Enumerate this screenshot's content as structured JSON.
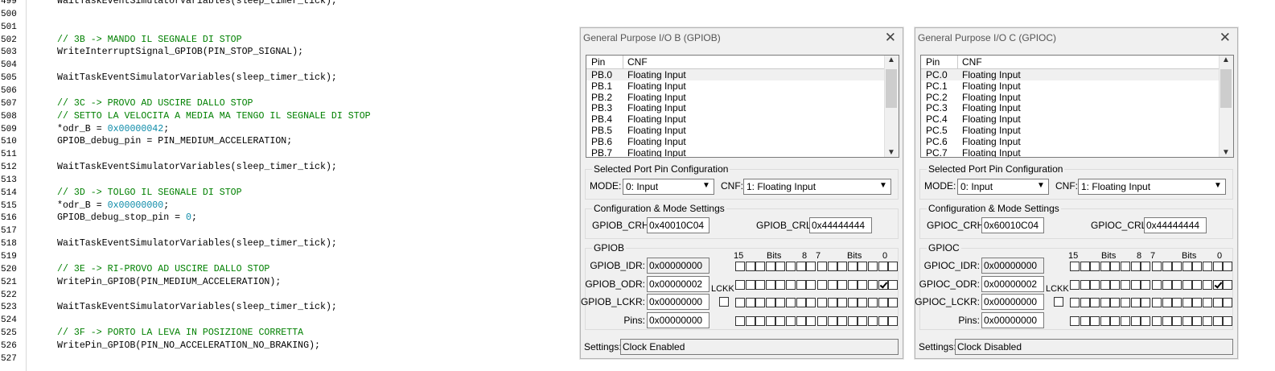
{
  "code": [
    {
      "ln": "499",
      "segments": [
        {
          "t": "WaitTaskEventSimulatorVariables(sleep_timer_tick);",
          "k": "code"
        }
      ]
    },
    {
      "ln": "500",
      "segments": []
    },
    {
      "ln": "501",
      "segments": []
    },
    {
      "ln": "502",
      "segments": [
        {
          "t": "// 3B -> MANDO IL SEGNALE DI STOP",
          "k": "comment"
        }
      ]
    },
    {
      "ln": "503",
      "segments": [
        {
          "t": "WriteInterruptSignal_GPIOB(PIN_STOP_SIGNAL);",
          "k": "code"
        }
      ]
    },
    {
      "ln": "504",
      "segments": []
    },
    {
      "ln": "505",
      "segments": [
        {
          "t": "WaitTaskEventSimulatorVariables(sleep_timer_tick);",
          "k": "code"
        }
      ]
    },
    {
      "ln": "506",
      "segments": []
    },
    {
      "ln": "507",
      "segments": [
        {
          "t": "// 3C -> PROVO AD USCIRE DALLO STOP",
          "k": "comment"
        }
      ]
    },
    {
      "ln": "508",
      "segments": [
        {
          "t": "// SETTO LA VELOCITA A MEDIA MA TENGO IL SEGNALE DI STOP",
          "k": "comment"
        }
      ]
    },
    {
      "ln": "509",
      "segments": [
        {
          "t": "*odr_B = ",
          "k": "code"
        },
        {
          "t": "0x00000042",
          "k": "num"
        },
        {
          "t": ";",
          "k": "code"
        }
      ]
    },
    {
      "ln": "510",
      "segments": [
        {
          "t": "GPIOB_debug_pin = PIN_MEDIUM_ACCELERATION;",
          "k": "code"
        }
      ]
    },
    {
      "ln": "511",
      "segments": []
    },
    {
      "ln": "512",
      "segments": [
        {
          "t": "WaitTaskEventSimulatorVariables(sleep_timer_tick);",
          "k": "code"
        }
      ]
    },
    {
      "ln": "513",
      "segments": []
    },
    {
      "ln": "514",
      "segments": [
        {
          "t": "// 3D -> TOLGO IL SEGNALE DI STOP",
          "k": "comment"
        }
      ]
    },
    {
      "ln": "515",
      "segments": [
        {
          "t": "*odr_B = ",
          "k": "code"
        },
        {
          "t": "0x00000000",
          "k": "num"
        },
        {
          "t": ";",
          "k": "code"
        }
      ]
    },
    {
      "ln": "516",
      "segments": [
        {
          "t": "GPIOB_debug_stop_pin = ",
          "k": "code"
        },
        {
          "t": "0",
          "k": "num"
        },
        {
          "t": ";",
          "k": "code"
        }
      ]
    },
    {
      "ln": "517",
      "segments": []
    },
    {
      "ln": "518",
      "segments": [
        {
          "t": "WaitTaskEventSimulatorVariables(sleep_timer_tick);",
          "k": "code"
        }
      ]
    },
    {
      "ln": "519",
      "segments": []
    },
    {
      "ln": "520",
      "segments": [
        {
          "t": "// 3E -> RI-PROVO AD USCIRE DALLO STOP",
          "k": "comment"
        }
      ]
    },
    {
      "ln": "521",
      "segments": [
        {
          "t": "WritePin_GPIOB(PIN_MEDIUM_ACCELERATION);",
          "k": "code"
        }
      ]
    },
    {
      "ln": "522",
      "segments": []
    },
    {
      "ln": "523",
      "segments": [
        {
          "t": "WaitTaskEventSimulatorVariables(sleep_timer_tick);",
          "k": "code"
        }
      ]
    },
    {
      "ln": "524",
      "segments": []
    },
    {
      "ln": "525",
      "segments": [
        {
          "t": "// 3F -> PORTO LA LEVA IN POSIZIONE CORRETTA",
          "k": "comment"
        }
      ]
    },
    {
      "ln": "526",
      "segments": [
        {
          "t": "WritePin_GPIOB(PIN_NO_ACCELERATION_NO_BRAKING);",
          "k": "code"
        }
      ]
    },
    {
      "ln": "527",
      "segments": []
    }
  ],
  "dialogs": [
    {
      "title": "General Purpose I/O B (GPIOB)",
      "close_glyph": "✕",
      "list_header": {
        "pin": "Pin",
        "cnf": "CNF"
      },
      "pins": [
        {
          "pin": "PB.0",
          "cnf": "Floating Input"
        },
        {
          "pin": "PB.1",
          "cnf": "Floating Input"
        },
        {
          "pin": "PB.2",
          "cnf": "Floating Input"
        },
        {
          "pin": "PB.3",
          "cnf": "Floating Input"
        },
        {
          "pin": "PB.4",
          "cnf": "Floating Input"
        },
        {
          "pin": "PB.5",
          "cnf": "Floating Input"
        },
        {
          "pin": "PB.6",
          "cnf": "Floating Input"
        },
        {
          "pin": "PB.7",
          "cnf": "Floating Input"
        }
      ],
      "selected_pin_group": "Selected Port Pin Configuration",
      "mode_label": "MODE:",
      "mode_value": "0: Input",
      "cnf_label": "CNF:",
      "cnf_value": "1: Floating Input",
      "cfg_group": "Configuration & Mode Settings",
      "crh_label": "GPIOB_CRH:",
      "crh_value": "0x40010C04",
      "crl_label": "GPIOB_CRL:",
      "crl_value": "0x44444444",
      "port_group": "GPIOB",
      "bits_header": {
        "b15": "15",
        "bits_a": "Bits",
        "b8": "8",
        "b7": "7",
        "bits_b": "Bits",
        "b0": "0"
      },
      "lckk_label": "LCKK",
      "regs": [
        {
          "label": "GPIOB_IDR:",
          "value": "0x00000000",
          "readonly": true
        },
        {
          "label": "GPIOB_ODR:",
          "value": "0x00000002",
          "readonly": false
        },
        {
          "label": "GPIOB_LCKR:",
          "value": "0x00000000",
          "readonly": false
        },
        {
          "label": "Pins:",
          "value": "0x00000000",
          "readonly": false
        }
      ],
      "odr_checked_bits": [
        1
      ],
      "settings_label": "Settings:",
      "settings_value": "Clock Enabled"
    },
    {
      "title": "General Purpose I/O C (GPIOC)",
      "close_glyph": "✕",
      "list_header": {
        "pin": "Pin",
        "cnf": "CNF"
      },
      "pins": [
        {
          "pin": "PC.0",
          "cnf": "Floating Input"
        },
        {
          "pin": "PC.1",
          "cnf": "Floating Input"
        },
        {
          "pin": "PC.2",
          "cnf": "Floating Input"
        },
        {
          "pin": "PC.3",
          "cnf": "Floating Input"
        },
        {
          "pin": "PC.4",
          "cnf": "Floating Input"
        },
        {
          "pin": "PC.5",
          "cnf": "Floating Input"
        },
        {
          "pin": "PC.6",
          "cnf": "Floating Input"
        },
        {
          "pin": "PC.7",
          "cnf": "Floating Input"
        }
      ],
      "selected_pin_group": "Selected Port Pin Configuration",
      "mode_label": "MODE:",
      "mode_value": "0: Input",
      "cnf_label": "CNF:",
      "cnf_value": "1: Floating Input",
      "cfg_group": "Configuration & Mode Settings",
      "crh_label": "GPIOC_CRH:",
      "crh_value": "0x60010C04",
      "crl_label": "GPIOC_CRL:",
      "crl_value": "0x44444444",
      "port_group": "GPIOC",
      "bits_header": {
        "b15": "15",
        "bits_a": "Bits",
        "b8": "8",
        "b7": "7",
        "bits_b": "Bits",
        "b0": "0"
      },
      "lckk_label": "LCKK",
      "regs": [
        {
          "label": "GPIOC_IDR:",
          "value": "0x00000000",
          "readonly": true
        },
        {
          "label": "GPIOC_ODR:",
          "value": "0x00000002",
          "readonly": false
        },
        {
          "label": "GPIOC_LCKR:",
          "value": "0x00000000",
          "readonly": false
        },
        {
          "label": "Pins:",
          "value": "0x00000000",
          "readonly": false
        }
      ],
      "odr_checked_bits": [
        1
      ],
      "settings_label": "Settings:",
      "settings_value": "Clock Disabled"
    }
  ],
  "icons": {
    "scroll_up": "▲",
    "scroll_down": "▼",
    "combo_arrow": "▼"
  },
  "colors": {
    "comment": "#008000",
    "number": "#0b8aa8",
    "dialog_bg": "#f0f0f0"
  }
}
